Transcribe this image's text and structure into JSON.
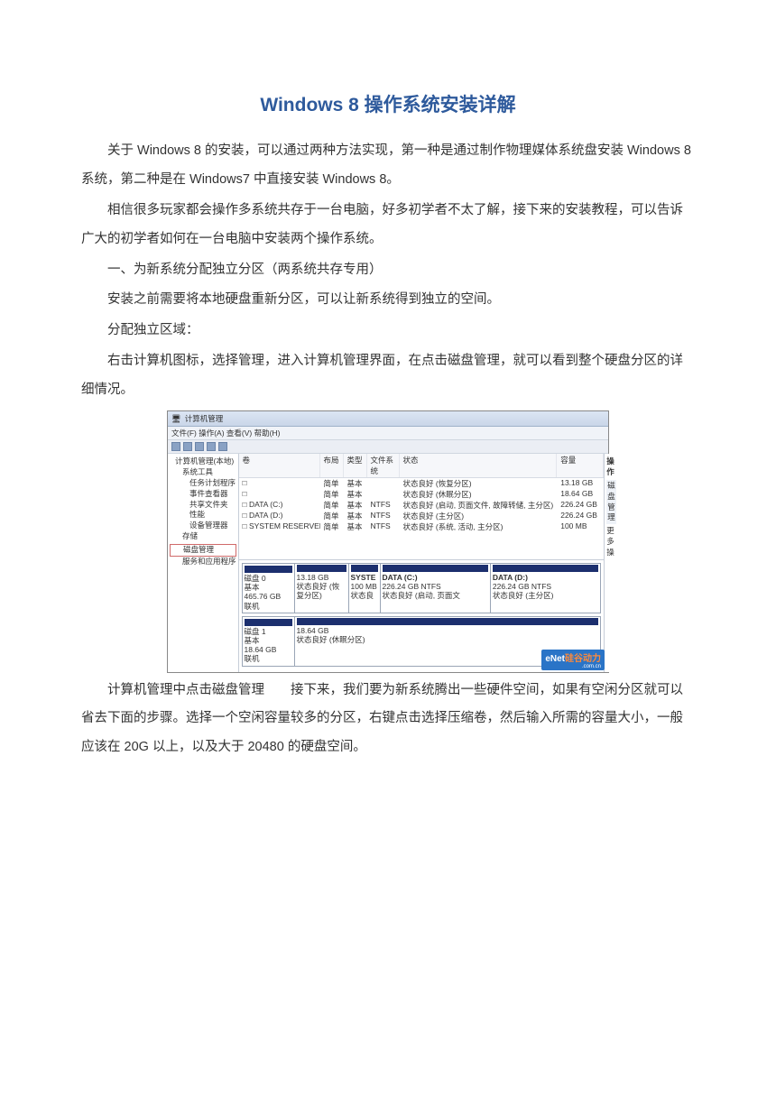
{
  "title": "Windows 8 操作系统安装详解",
  "paragraphs": {
    "p1": "关于 Windows 8 的安装，可以通过两种方法实现，第一种是通过制作物理媒体系统盘安装 Windows 8 系统，第二种是在 Windows7 中直接安装 Windows 8。",
    "p2": "相信很多玩家都会操作多系统共存于一台电脑，好多初学者不太了解，接下来的安装教程，可以告诉广大的初学者如何在一台电脑中安装两个操作系统。",
    "p3": "一、为新系统分配独立分区（两系统共存专用）",
    "p4": "安装之前需要将本地硬盘重新分区，可以让新系统得到独立的空间。",
    "p5": "分配独立区域：",
    "p6": "右击计算机图标，选择管理，进入计算机管理界面，在点击磁盘管理，就可以看到整个硬盘分区的详细情况。",
    "p7": "计算机管理中点击磁盘管理　　接下来，我们要为新系统腾出一些硬件空间，如果有空闲分区就可以省去下面的步骤。选择一个空闲容量较多的分区，右键点击选择压缩卷，然后输入所需的容量大小，一般应该在 20G 以上，以及大于 20480 的硬盘空间。"
  },
  "screenshot": {
    "window_title": "计算机管理",
    "menu": "文件(F)  操作(A)  查看(V)  帮助(H)",
    "tree": {
      "root": "计算机管理(本地)",
      "sys_tools": "系统工具",
      "task": "任务计划程序",
      "event": "事件查看器",
      "shared": "共享文件夹",
      "perf": "性能",
      "device": "设备管理器",
      "storage": "存储",
      "disk_mgmt": "磁盘管理",
      "svc": "服务和应用程序"
    },
    "volumes": {
      "headers": {
        "vol": "卷",
        "layout": "布局",
        "type": "类型",
        "fs": "文件系统",
        "status": "状态",
        "capacity": "容量"
      },
      "rows": [
        {
          "vol": "□",
          "layout": "简单",
          "type": "基本",
          "fs": "",
          "status": "状态良好 (恢复分区)",
          "capacity": "13.18 GB"
        },
        {
          "vol": "□",
          "layout": "简单",
          "type": "基本",
          "fs": "",
          "status": "状态良好 (休眠分区)",
          "capacity": "18.64 GB"
        },
        {
          "vol": "□ DATA (C:)",
          "layout": "简单",
          "type": "基本",
          "fs": "NTFS",
          "status": "状态良好 (启动, 页面文件, 故障转储, 主分区)",
          "capacity": "226.24 GB"
        },
        {
          "vol": "□ DATA (D:)",
          "layout": "简单",
          "type": "基本",
          "fs": "NTFS",
          "status": "状态良好 (主分区)",
          "capacity": "226.24 GB"
        },
        {
          "vol": "□ SYSTEM RESERVED",
          "layout": "简单",
          "type": "基本",
          "fs": "NTFS",
          "status": "状态良好 (系统, 活动, 主分区)",
          "capacity": "100 MB"
        }
      ]
    },
    "disks": {
      "d0": {
        "label": "磁盘 0",
        "type": "基本",
        "size": "465.76 GB",
        "status": "联机",
        "parts": [
          {
            "title": "",
            "size": "13.18 GB",
            "status": "状态良好 (恢复分区)"
          },
          {
            "title": "SYSTE",
            "size": "100 MB",
            "status": "状态良"
          },
          {
            "title": "DATA (C:)",
            "size": "226.24 GB NTFS",
            "status": "状态良好 (启动, 页面文"
          },
          {
            "title": "DATA (D:)",
            "size": "226.24 GB NTFS",
            "status": "状态良好 (主分区)"
          }
        ]
      },
      "d1": {
        "label": "磁盘 1",
        "type": "基本",
        "size": "18.64 GB",
        "status": "联机",
        "parts": [
          {
            "title": "",
            "size": "18.64 GB",
            "status": "状态良好 (休眠分区)"
          }
        ]
      }
    },
    "right_panel": {
      "title": "操作",
      "item1": "磁盘管理",
      "item2": "更多操"
    },
    "logo": {
      "brand": "eNet",
      "accent": "硅谷动力",
      "sub": ".com.cn"
    }
  }
}
